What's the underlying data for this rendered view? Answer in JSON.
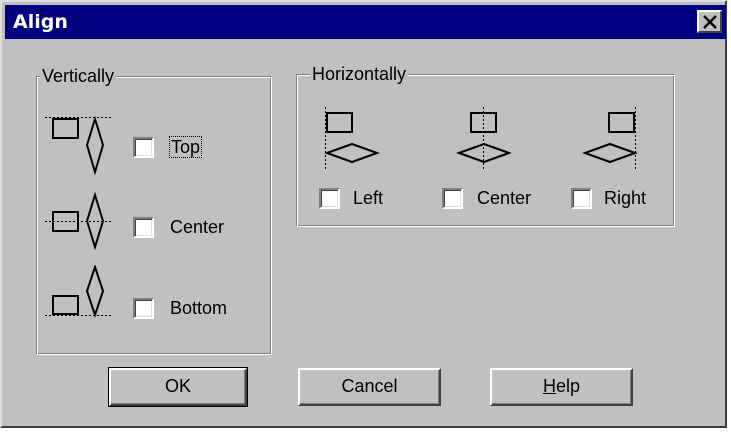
{
  "window": {
    "title": "Align"
  },
  "vertical": {
    "legend": "Vertically",
    "options": [
      {
        "label": "Top",
        "checked": false,
        "icon": "align-top-icon"
      },
      {
        "label": "Center",
        "checked": false,
        "icon": "align-vertical-center-icon"
      },
      {
        "label": "Bottom",
        "checked": false,
        "icon": "align-bottom-icon"
      }
    ]
  },
  "horizontal": {
    "legend": "Horizontally",
    "options": [
      {
        "label": "Left",
        "checked": false,
        "icon": "align-left-icon"
      },
      {
        "label": "Center",
        "checked": false,
        "icon": "align-horizontal-center-icon"
      },
      {
        "label": "Right",
        "checked": false,
        "icon": "align-right-icon"
      }
    ]
  },
  "buttons": {
    "ok": "OK",
    "cancel": "Cancel",
    "help_pre": "",
    "help_mn": "H",
    "help_post": "elp"
  },
  "colors": {
    "titlebar": "#000080",
    "face": "#c0c0c0"
  }
}
